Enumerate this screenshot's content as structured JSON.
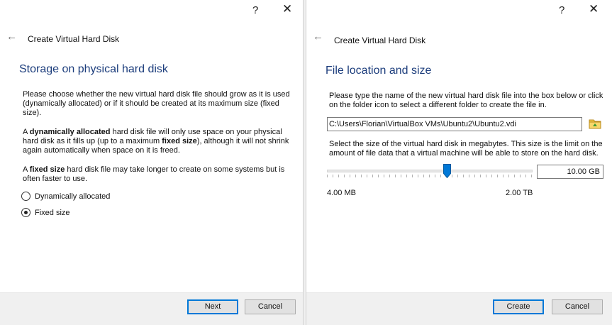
{
  "dialog1": {
    "help": "?",
    "close": "✕",
    "back": "←",
    "title": "Create Virtual Hard Disk",
    "page_title": "Storage on physical hard disk",
    "para1": "Please choose whether the new virtual hard disk file should grow as it is used (dynamically allocated) or if it should be created at its maximum size (fixed size).",
    "para2": {
      "pre": "A ",
      "b1": "dynamically allocated",
      "mid": " hard disk file will only use space on your physical hard disk as it fills up (up to a maximum ",
      "b2": "fixed size",
      "post": "), although it will not shrink again automatically when space on it is freed."
    },
    "para3": {
      "pre": "A ",
      "b1": "fixed size",
      "post": " hard disk file may take longer to create on some systems but is often faster to use."
    },
    "options": [
      {
        "label": "Dynamically allocated",
        "checked": false
      },
      {
        "label": "Fixed size",
        "checked": true
      }
    ],
    "next_label": "Next",
    "cancel_label": "Cancel"
  },
  "dialog2": {
    "help": "?",
    "close": "✕",
    "back": "←",
    "title": "Create Virtual Hard Disk",
    "page_title": "File location and size",
    "para1": "Please type the name of the new virtual hard disk file into the box below or click on the folder icon to select a different folder to create the file in.",
    "path_value": "C:\\Users\\Florian\\VirtualBox VMs\\Ubuntu2\\Ubuntu2.vdi",
    "para2": "Select the size of the virtual hard disk in megabytes. This size is the limit on the amount of file data that a virtual machine will be able to store on the hard disk.",
    "size_value": "10.00 GB",
    "slider_level": 0.58,
    "min_label": "4.00 MB",
    "max_label": "2.00 TB",
    "create_label": "Create",
    "cancel_label": "Cancel"
  },
  "icons": {
    "folder": "folder-icon",
    "slider": "slider-thumb"
  },
  "colors": {
    "accent": "#0078d7",
    "heading": "#1c3d7c",
    "footer": "#f0f0f0"
  }
}
